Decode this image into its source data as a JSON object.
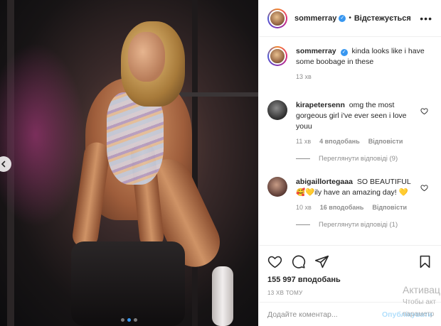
{
  "post": {
    "username": "sommerray",
    "verified_icon": "check-badge-icon",
    "follow_status": "Відстежується",
    "more_icon": "more-horizontal-icon"
  },
  "caption": {
    "username": "sommerray",
    "text": "kinda looks like i have some boobage in these",
    "time": "13 хв"
  },
  "comments": [
    {
      "username": "kirapetersenn",
      "text": "omg the most gorgeous girl i've ever seen i love youu",
      "time": "11 хв",
      "likes": "4 вподобань",
      "reply_label": "Відповісти",
      "view_replies": "Переглянути відповіді (9)"
    },
    {
      "username": "abigaillortegaaa",
      "text": "SO BEAUTIFUL 🥰💛ily have an amazing day! 💛",
      "time": "10 хв",
      "likes": "16 вподобань",
      "reply_label": "Відповісти",
      "view_replies": "Переглянути відповіді (1)"
    }
  ],
  "actions": {
    "like_icon": "heart-icon",
    "comment_icon": "comment-icon",
    "share_icon": "send-icon",
    "save_icon": "bookmark-icon",
    "likes_count": "155 997 вподобань",
    "time_ago": "13 ХВ ТОМУ"
  },
  "add_comment": {
    "placeholder": "Додайте коментар...",
    "publish_label": "Опублікувати"
  },
  "watermark": {
    "line1": "Активац",
    "line2": "Чтобы акт",
    "line3": "параметр"
  },
  "carousel": {
    "prev_icon": "chevron-left-icon",
    "slides": 3,
    "active_slide": 2
  },
  "colors": {
    "accent": "#3897f0",
    "text": "#262626",
    "muted": "#8e8e8e",
    "publish_disabled": "#b2dffc"
  }
}
